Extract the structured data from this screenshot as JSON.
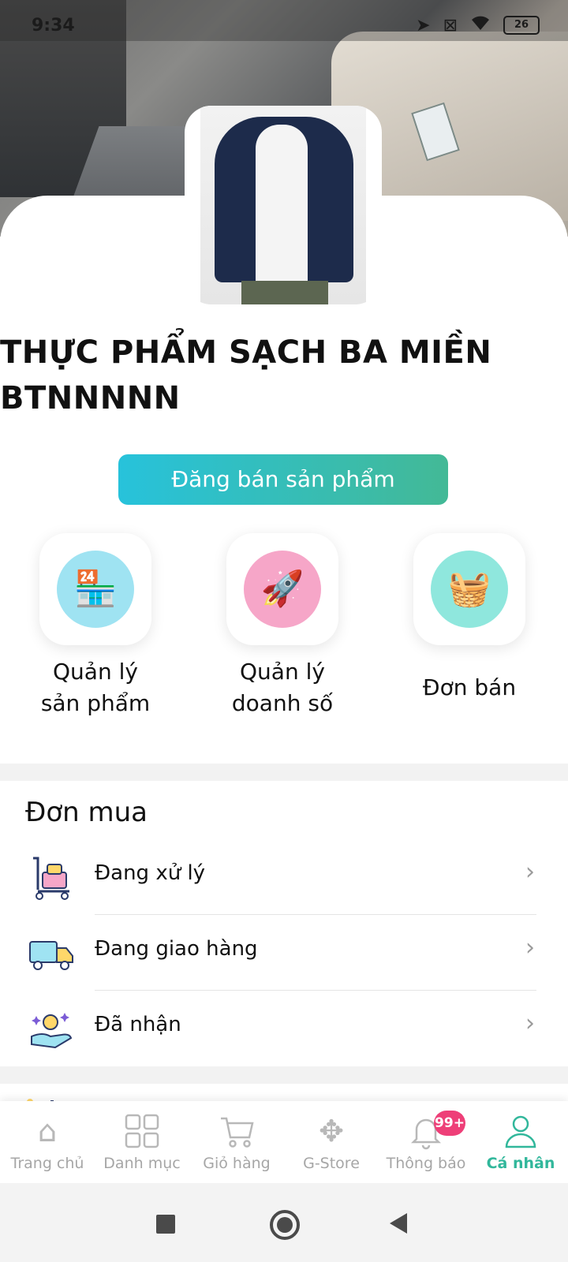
{
  "status_bar": {
    "time": "9:34",
    "battery": "26"
  },
  "profile": {
    "shop_name_line1": "THỰC PHẨM SẠCH BA MIỀN",
    "shop_name_line2": "BTNNNNN"
  },
  "actions": {
    "post_product": "Đăng bán sản phẩm"
  },
  "tools": [
    {
      "line1": "Quản lý",
      "line2": "sản phẩm",
      "icon": "store-management-icon",
      "color": "#9fe3f2"
    },
    {
      "line1": "Quản lý",
      "line2": "doanh số",
      "icon": "rocket-icon",
      "color": "#f6a6c8"
    },
    {
      "line1": "Đơn bán",
      "line2": "",
      "icon": "sales-orders-icon",
      "color": "#8fe7dd"
    }
  ],
  "purchases": {
    "title": "Đơn mua",
    "items": [
      {
        "label": "Đang xử lý",
        "icon": "trolley-icon"
      },
      {
        "label": "Đang giao hàng",
        "icon": "delivery-truck-icon"
      },
      {
        "label": "Đã nhận",
        "icon": "received-hand-icon"
      }
    ]
  },
  "tabbar": {
    "tabs": [
      {
        "label": "Trang chủ",
        "icon": "home-icon"
      },
      {
        "label": "Danh mục",
        "icon": "grid-icon"
      },
      {
        "label": "Giỏ hàng",
        "icon": "cart-icon"
      },
      {
        "label": "G-Store",
        "icon": "gstore-icon"
      },
      {
        "label": "Thông báo",
        "icon": "bell-icon",
        "badge": "99+"
      },
      {
        "label": "Cá nhân",
        "icon": "profile-icon",
        "active": true
      }
    ],
    "accent": "#31b79b"
  }
}
